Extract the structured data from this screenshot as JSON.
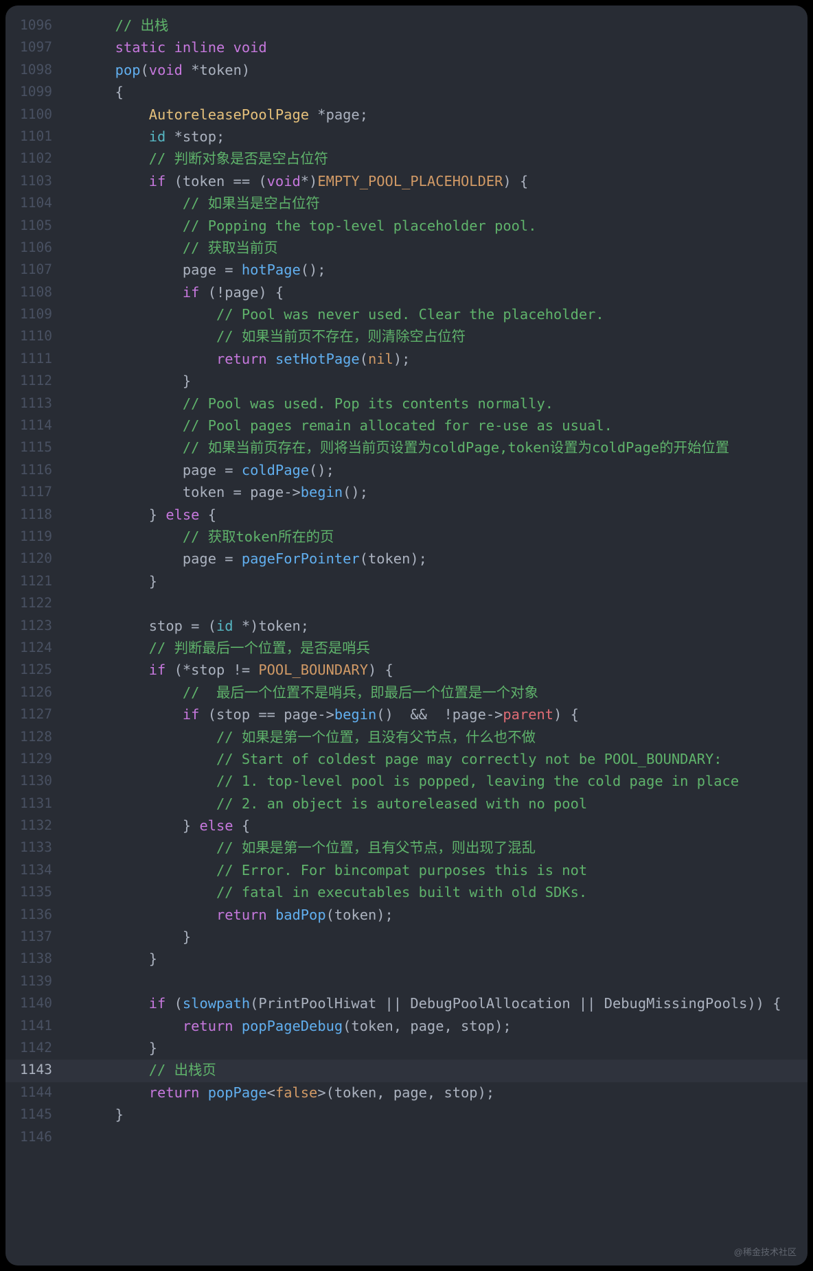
{
  "watermark": "@稀金技术社区",
  "code": {
    "first_line": 1096,
    "highlight_line": 1143,
    "lines": [
      {
        "n": 1096,
        "indent": 1,
        "tokens": [
          {
            "t": "comment",
            "v": "// 出栈"
          }
        ]
      },
      {
        "n": 1097,
        "indent": 1,
        "tokens": [
          {
            "t": "keyword",
            "v": "static"
          },
          {
            "t": "default",
            "v": " "
          },
          {
            "t": "keyword",
            "v": "inline"
          },
          {
            "t": "default",
            "v": " "
          },
          {
            "t": "keyword",
            "v": "void"
          }
        ]
      },
      {
        "n": 1098,
        "indent": 1,
        "tokens": [
          {
            "t": "func",
            "v": "pop"
          },
          {
            "t": "punc",
            "v": "("
          },
          {
            "t": "keyword",
            "v": "void"
          },
          {
            "t": "default",
            "v": " "
          },
          {
            "t": "punc",
            "v": "*"
          },
          {
            "t": "default",
            "v": "token"
          },
          {
            "t": "punc",
            "v": ")"
          }
        ]
      },
      {
        "n": 1099,
        "indent": 1,
        "tokens": [
          {
            "t": "punc",
            "v": "{"
          }
        ]
      },
      {
        "n": 1100,
        "indent": 2,
        "tokens": [
          {
            "t": "const",
            "v": "AutoreleasePoolPage"
          },
          {
            "t": "default",
            "v": " "
          },
          {
            "t": "default",
            "v": "*"
          },
          {
            "t": "default",
            "v": "page"
          },
          {
            "t": "default",
            "v": ";"
          }
        ]
      },
      {
        "n": 1101,
        "indent": 2,
        "tokens": [
          {
            "t": "type",
            "v": "id"
          },
          {
            "t": "default",
            "v": " *stop;"
          }
        ]
      },
      {
        "n": 1102,
        "indent": 2,
        "tokens": [
          {
            "t": "comment",
            "v": "// 判断对象是否是空占位符"
          }
        ]
      },
      {
        "n": 1103,
        "indent": 2,
        "tokens": [
          {
            "t": "keyword",
            "v": "if"
          },
          {
            "t": "default",
            "v": " (token == ("
          },
          {
            "t": "keyword",
            "v": "void"
          },
          {
            "t": "default",
            "v": "*)"
          },
          {
            "t": "tmpl",
            "v": "EMPTY_POOL_PLACEHOLDER"
          },
          {
            "t": "default",
            "v": ") {"
          }
        ]
      },
      {
        "n": 1104,
        "indent": 3,
        "tokens": [
          {
            "t": "comment",
            "v": "// 如果当是空占位符"
          }
        ]
      },
      {
        "n": 1105,
        "indent": 3,
        "tokens": [
          {
            "t": "comment",
            "v": "// Popping the top-level placeholder pool."
          }
        ]
      },
      {
        "n": 1106,
        "indent": 3,
        "tokens": [
          {
            "t": "comment",
            "v": "// 获取当前页"
          }
        ]
      },
      {
        "n": 1107,
        "indent": 3,
        "tokens": [
          {
            "t": "default",
            "v": "page = "
          },
          {
            "t": "func",
            "v": "hotPage"
          },
          {
            "t": "default",
            "v": "();"
          }
        ]
      },
      {
        "n": 1108,
        "indent": 3,
        "tokens": [
          {
            "t": "keyword",
            "v": "if"
          },
          {
            "t": "default",
            "v": " (!page) {"
          }
        ]
      },
      {
        "n": 1109,
        "indent": 4,
        "tokens": [
          {
            "t": "comment",
            "v": "// Pool was never used. Clear the placeholder."
          }
        ]
      },
      {
        "n": 1110,
        "indent": 4,
        "tokens": [
          {
            "t": "comment",
            "v": "// 如果当前页不存在，则清除空占位符"
          }
        ]
      },
      {
        "n": 1111,
        "indent": 4,
        "tokens": [
          {
            "t": "keyword",
            "v": "return"
          },
          {
            "t": "default",
            "v": " "
          },
          {
            "t": "func",
            "v": "setHotPage"
          },
          {
            "t": "default",
            "v": "("
          },
          {
            "t": "tmpl",
            "v": "nil"
          },
          {
            "t": "default",
            "v": ");"
          }
        ]
      },
      {
        "n": 1112,
        "indent": 3,
        "tokens": [
          {
            "t": "default",
            "v": "}"
          }
        ]
      },
      {
        "n": 1113,
        "indent": 3,
        "tokens": [
          {
            "t": "comment",
            "v": "// Pool was used. Pop its contents normally."
          }
        ]
      },
      {
        "n": 1114,
        "indent": 3,
        "tokens": [
          {
            "t": "comment",
            "v": "// Pool pages remain allocated for re-use as usual."
          }
        ]
      },
      {
        "n": 1115,
        "indent": 3,
        "tokens": [
          {
            "t": "comment",
            "v": "// 如果当前页存在，则将当前页设置为coldPage,token设置为coldPage的开始位置"
          }
        ]
      },
      {
        "n": 1116,
        "indent": 3,
        "tokens": [
          {
            "t": "default",
            "v": "page = "
          },
          {
            "t": "func",
            "v": "coldPage"
          },
          {
            "t": "default",
            "v": "();"
          }
        ]
      },
      {
        "n": 1117,
        "indent": 3,
        "tokens": [
          {
            "t": "default",
            "v": "token = page->"
          },
          {
            "t": "func",
            "v": "begin"
          },
          {
            "t": "default",
            "v": "();"
          }
        ]
      },
      {
        "n": 1118,
        "indent": 2,
        "tokens": [
          {
            "t": "default",
            "v": "} "
          },
          {
            "t": "keyword",
            "v": "else"
          },
          {
            "t": "default",
            "v": " {"
          }
        ]
      },
      {
        "n": 1119,
        "indent": 3,
        "tokens": [
          {
            "t": "comment",
            "v": "// 获取token所在的页"
          }
        ]
      },
      {
        "n": 1120,
        "indent": 3,
        "tokens": [
          {
            "t": "default",
            "v": "page = "
          },
          {
            "t": "func",
            "v": "pageForPointer"
          },
          {
            "t": "default",
            "v": "(token);"
          }
        ]
      },
      {
        "n": 1121,
        "indent": 2,
        "tokens": [
          {
            "t": "default",
            "v": "}"
          }
        ]
      },
      {
        "n": 1122,
        "indent": 0,
        "tokens": [
          {
            "t": "default",
            "v": ""
          }
        ]
      },
      {
        "n": 1123,
        "indent": 2,
        "tokens": [
          {
            "t": "default",
            "v": "stop = ("
          },
          {
            "t": "type",
            "v": "id"
          },
          {
            "t": "default",
            "v": " *)token;"
          }
        ]
      },
      {
        "n": 1124,
        "indent": 2,
        "tokens": [
          {
            "t": "comment",
            "v": "// 判断最后一个位置，是否是哨兵"
          }
        ]
      },
      {
        "n": 1125,
        "indent": 2,
        "tokens": [
          {
            "t": "keyword",
            "v": "if"
          },
          {
            "t": "default",
            "v": " (*stop != "
          },
          {
            "t": "tmpl",
            "v": "POOL_BOUNDARY"
          },
          {
            "t": "default",
            "v": ") {"
          }
        ]
      },
      {
        "n": 1126,
        "indent": 3,
        "tokens": [
          {
            "t": "comment",
            "v": "//  最后一个位置不是哨兵，即最后一个位置是一个对象"
          }
        ]
      },
      {
        "n": 1127,
        "indent": 3,
        "tokens": [
          {
            "t": "keyword",
            "v": "if"
          },
          {
            "t": "default",
            "v": " (stop == page->"
          },
          {
            "t": "func",
            "v": "begin"
          },
          {
            "t": "default",
            "v": "()  &&  !page->"
          },
          {
            "t": "ident",
            "v": "parent"
          },
          {
            "t": "default",
            "v": ") {"
          }
        ]
      },
      {
        "n": 1128,
        "indent": 4,
        "tokens": [
          {
            "t": "comment",
            "v": "// 如果是第一个位置，且没有父节点，什么也不做"
          }
        ]
      },
      {
        "n": 1129,
        "indent": 4,
        "tokens": [
          {
            "t": "comment",
            "v": "// Start of coldest page may correctly not be POOL_BOUNDARY:"
          }
        ]
      },
      {
        "n": 1130,
        "indent": 4,
        "tokens": [
          {
            "t": "comment",
            "v": "// 1. top-level pool is popped, leaving the cold page in place"
          }
        ]
      },
      {
        "n": 1131,
        "indent": 4,
        "tokens": [
          {
            "t": "comment",
            "v": "// 2. an object is autoreleased with no pool"
          }
        ]
      },
      {
        "n": 1132,
        "indent": 3,
        "tokens": [
          {
            "t": "default",
            "v": "} "
          },
          {
            "t": "keyword",
            "v": "else"
          },
          {
            "t": "default",
            "v": " {"
          }
        ]
      },
      {
        "n": 1133,
        "indent": 4,
        "tokens": [
          {
            "t": "comment",
            "v": "// 如果是第一个位置，且有父节点，则出现了混乱"
          }
        ]
      },
      {
        "n": 1134,
        "indent": 4,
        "tokens": [
          {
            "t": "comment",
            "v": "// Error. For bincompat purposes this is not"
          }
        ]
      },
      {
        "n": 1135,
        "indent": 4,
        "tokens": [
          {
            "t": "comment",
            "v": "// fatal in executables built with old SDKs."
          }
        ]
      },
      {
        "n": 1136,
        "indent": 4,
        "tokens": [
          {
            "t": "keyword",
            "v": "return"
          },
          {
            "t": "default",
            "v": " "
          },
          {
            "t": "func",
            "v": "badPop"
          },
          {
            "t": "default",
            "v": "(token);"
          }
        ]
      },
      {
        "n": 1137,
        "indent": 3,
        "tokens": [
          {
            "t": "default",
            "v": "}"
          }
        ]
      },
      {
        "n": 1138,
        "indent": 2,
        "tokens": [
          {
            "t": "default",
            "v": "}"
          }
        ]
      },
      {
        "n": 1139,
        "indent": 0,
        "tokens": [
          {
            "t": "default",
            "v": ""
          }
        ]
      },
      {
        "n": 1140,
        "indent": 2,
        "tokens": [
          {
            "t": "keyword",
            "v": "if"
          },
          {
            "t": "default",
            "v": " ("
          },
          {
            "t": "func",
            "v": "slowpath"
          },
          {
            "t": "default",
            "v": "(PrintPoolHiwat || DebugPoolAllocation || DebugMissingPools)) {"
          }
        ]
      },
      {
        "n": 1141,
        "indent": 3,
        "tokens": [
          {
            "t": "keyword",
            "v": "return"
          },
          {
            "t": "default",
            "v": " "
          },
          {
            "t": "func",
            "v": "popPageDebug"
          },
          {
            "t": "default",
            "v": "(token, page, stop);"
          }
        ]
      },
      {
        "n": 1142,
        "indent": 2,
        "tokens": [
          {
            "t": "default",
            "v": "}"
          }
        ]
      },
      {
        "n": 1143,
        "indent": 2,
        "tokens": [
          {
            "t": "comment",
            "v": "// 出栈页"
          }
        ]
      },
      {
        "n": 1144,
        "indent": 2,
        "tokens": [
          {
            "t": "keyword",
            "v": "return"
          },
          {
            "t": "default",
            "v": " "
          },
          {
            "t": "func",
            "v": "popPage"
          },
          {
            "t": "default",
            "v": "<"
          },
          {
            "t": "tmpl",
            "v": "false"
          },
          {
            "t": "default",
            "v": ">(token, page, stop);"
          }
        ]
      },
      {
        "n": 1145,
        "indent": 1,
        "tokens": [
          {
            "t": "default",
            "v": "}"
          }
        ]
      },
      {
        "n": 1146,
        "indent": 0,
        "tokens": [
          {
            "t": "default",
            "v": ""
          }
        ]
      }
    ]
  },
  "indent_unit": "    ",
  "base_indent": "  "
}
